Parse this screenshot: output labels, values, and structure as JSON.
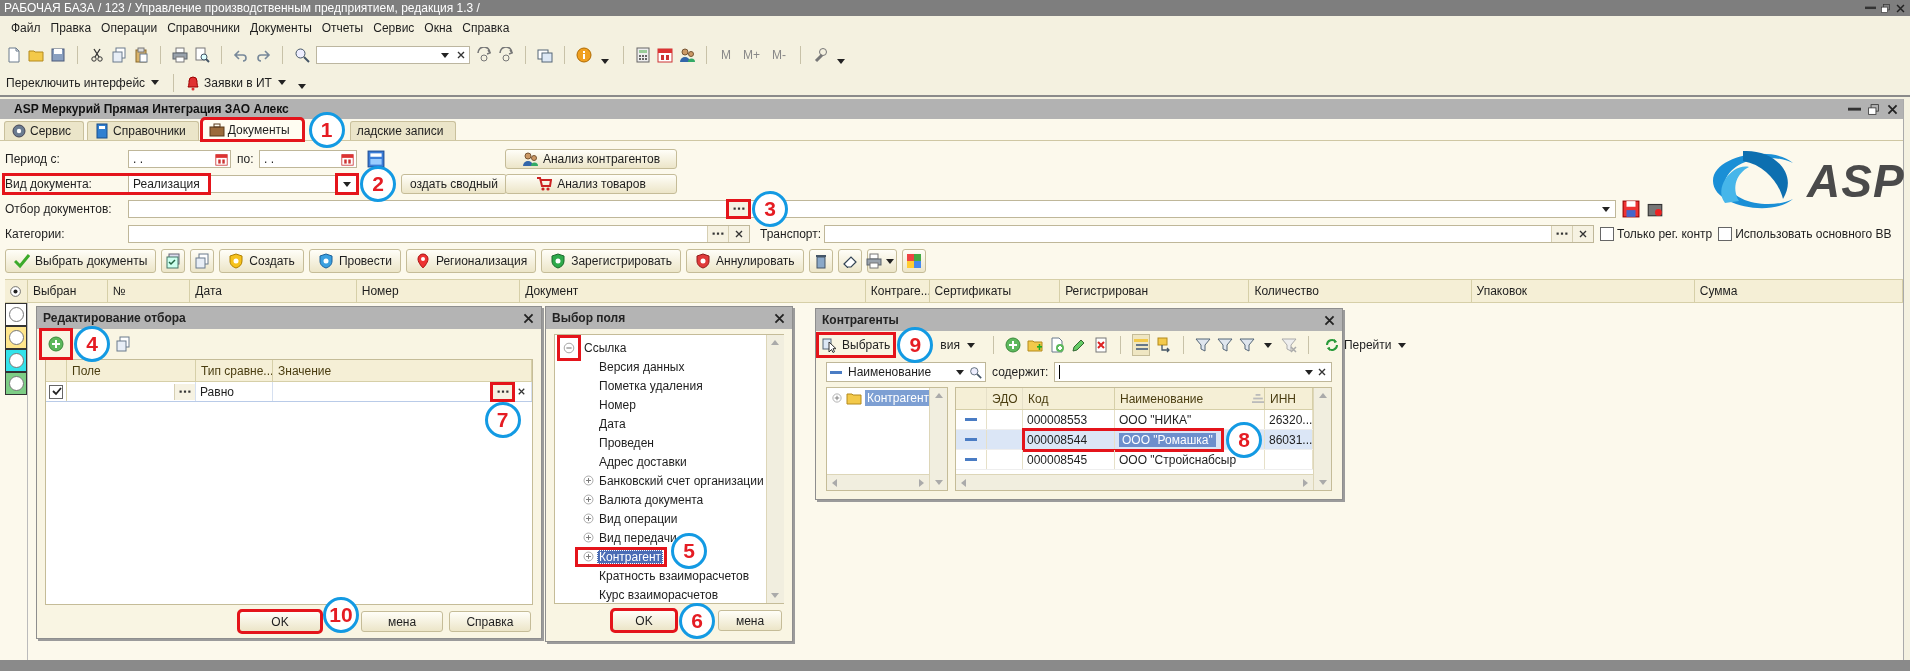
{
  "app": {
    "title": "РАБОЧАЯ БАЗА / 123 / Управление производственным предприятием, редакция 1.3 /"
  },
  "menu": [
    "Файл",
    "Правка",
    "Операции",
    "Справочники",
    "Документы",
    "Отчеты",
    "Сервис",
    "Окна",
    "Справка"
  ],
  "toolbar": {
    "memory_buttons": [
      "M",
      "M+",
      "M-"
    ]
  },
  "toolbar2": [
    "Переключить интерфейс",
    "Заявки в ИТ"
  ],
  "form": {
    "title": "ASP Меркурий Прямая Интеграция ЗАО Алекс",
    "tabs": [
      {
        "label": "Сервис",
        "selected": false
      },
      {
        "label": "Справочники",
        "selected": false
      },
      {
        "label": "Документы",
        "selected": true,
        "highlight": true,
        "callout": "1"
      },
      {
        "label": "ладские записи",
        "selected": false
      }
    ],
    "period": {
      "label": "Период с:",
      "from": ". .",
      "to_label": "по:",
      "to": ". ."
    },
    "doc_type": {
      "label": "Вид документа:",
      "value": "Реализация",
      "highlight": true,
      "callout": "2"
    },
    "summary_button": "оздать сводный",
    "analysis_buttons": [
      "Анализ контрагентов",
      "Анализ товаров"
    ],
    "filter": {
      "label": "Отбор документов:",
      "highlight": true,
      "callout": "3"
    },
    "categories": {
      "label": "Категории:"
    },
    "transport": {
      "label": "Транспорт:"
    },
    "options": [
      {
        "label": "Только рег. контр",
        "checked": false
      },
      {
        "label": "Использовать основного ВВ",
        "checked": false
      }
    ],
    "logo": "ASP",
    "actions": [
      "Выбрать документы",
      "Создать",
      "Провести",
      "Регионализация",
      "Зарегистрировать",
      "Аннулировать"
    ],
    "table": {
      "columns": [
        "Выбран",
        "№",
        "Дата",
        "Номер",
        "Документ",
        "Контраге...",
        "Сертификаты",
        "Регистрирован",
        "Количество",
        "Упаковок",
        "Сумма"
      ],
      "row_markers": [
        {
          "color": "#ffffff"
        },
        {
          "color": "#ffe68c"
        },
        {
          "color": "#33e3ea"
        },
        {
          "color": "#7dcd85"
        }
      ]
    }
  },
  "filter_editor": {
    "title": "Редактирование отбора",
    "add_button": {
      "highlight": true,
      "callout": "4"
    },
    "columns": [
      "Поле",
      "Тип сравне...",
      "Значение"
    ],
    "rows": [
      {
        "checked": true,
        "comparison": "Равно",
        "choice_highlight": true,
        "callout": "7"
      }
    ],
    "buttons": [
      {
        "label": "OK",
        "highlight": true,
        "callout": "10"
      },
      {
        "label": "мена"
      },
      {
        "label": "Справка"
      }
    ]
  },
  "field_picker": {
    "title": "Выбор поля",
    "tree": [
      {
        "label": "Ссылка",
        "kind": "group",
        "expanded": true,
        "selected": false,
        "expander_highlight": true,
        "children": [
          {
            "label": "Версия данных",
            "kind": "field",
            "selected": false
          },
          {
            "label": "Пометка удаления",
            "kind": "field",
            "selected": false
          },
          {
            "label": "Номер",
            "kind": "field",
            "selected": false
          },
          {
            "label": "Дата",
            "kind": "field",
            "selected": false
          },
          {
            "label": "Проведен",
            "kind": "field",
            "selected": false
          },
          {
            "label": "Адрес доставки",
            "kind": "field",
            "selected": false
          },
          {
            "label": "Банковский счет организации",
            "kind": "group",
            "expanded": false,
            "selected": false
          },
          {
            "label": "Валюта документа",
            "kind": "group",
            "expanded": false,
            "selected": false
          },
          {
            "label": "Вид операции",
            "kind": "group",
            "expanded": false,
            "selected": false
          },
          {
            "label": "Вид передачи",
            "kind": "group",
            "expanded": false,
            "selected": false
          },
          {
            "label": "Контрагент",
            "kind": "group",
            "expanded": false,
            "selected": true,
            "highlight": true,
            "callout": "5"
          },
          {
            "label": "Кратность взаиморасчетов",
            "kind": "field",
            "selected": false
          },
          {
            "label": "Курс взаиморасчетов",
            "kind": "field",
            "selected": false
          }
        ]
      }
    ],
    "buttons": [
      {
        "label": "OK",
        "highlight": true,
        "callout": "6"
      },
      {
        "label": "мена"
      }
    ]
  },
  "counterparties": {
    "title": "Контрагенты",
    "select_button": {
      "label": "Выбрать",
      "highlight": true,
      "callout": "9"
    },
    "actions_menu": "вия",
    "goto_menu": "Перейти",
    "search": {
      "field": "Наименование",
      "label": "содержит:"
    },
    "folders": [
      {
        "label": "Контрагент",
        "selected": true,
        "expanded": false
      }
    ],
    "columns": [
      "ЭДО",
      "Код",
      "Наименование",
      "ИНН"
    ],
    "rows": [
      {
        "code": "000008553",
        "name": "ООО \"НИКА\"",
        "inn": "26320...",
        "selected": false
      },
      {
        "code": "000008544",
        "name": "ООО \"Ромашка\"",
        "inn": "86031...",
        "selected": true,
        "highlight": true,
        "callout": "8"
      },
      {
        "code": "000008545",
        "name": "ООО \"Стройснабсыр",
        "selected": false
      }
    ]
  }
}
